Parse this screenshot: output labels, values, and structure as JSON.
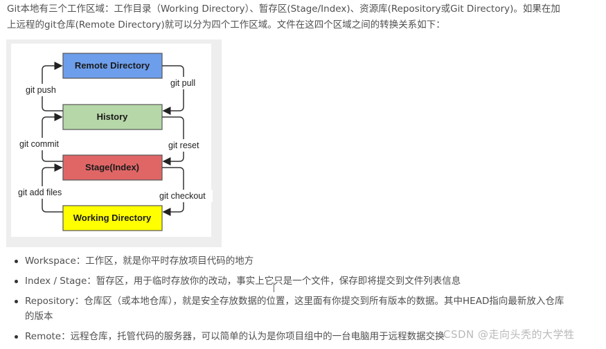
{
  "intro": {
    "line1": "Git本地有三个工作区域：工作目录（Working Directory）、暂存区(Stage/Index)、资源库(Repository或Git Directory)。如果在加",
    "line2": "上远程的git仓库(Remote Directory)就可以分为四个工作区域。文件在这四个区域之间的转换关系如下："
  },
  "diagram": {
    "boxes": [
      {
        "label": "Remote Directory",
        "color": "#6d9eeb"
      },
      {
        "label": "History",
        "color": "#b6d7a8"
      },
      {
        "label": "Stage(Index)",
        "color": "#e06666"
      },
      {
        "label": "Working Directory",
        "color": "#ffff00"
      }
    ],
    "left_commands": [
      "git push",
      "git commit",
      "git add files"
    ],
    "right_commands": [
      "git pull",
      "git reset",
      "git checkout"
    ]
  },
  "points": [
    {
      "text": "Workspace：工作区，就是你平时存放项目代码的地方"
    },
    {
      "text": "Index / Stage：暂存区，用于临时存放你的改动，事实上它只是一个文件，保存即将提交到文件列表信息"
    },
    {
      "text": "Repository：仓库区（或本地仓库），就是安全存放数据的位置，这里面有你提交到所有版本的数据。其中HEAD指向最新放入仓库的版本"
    },
    {
      "text": "Remote：远程仓库，托管代码的服务器，可以简单的认为是你项目组中的一台电脑用于远程数据交换"
    }
  ],
  "watermark": "CSDN @走向头秃的大学牲"
}
